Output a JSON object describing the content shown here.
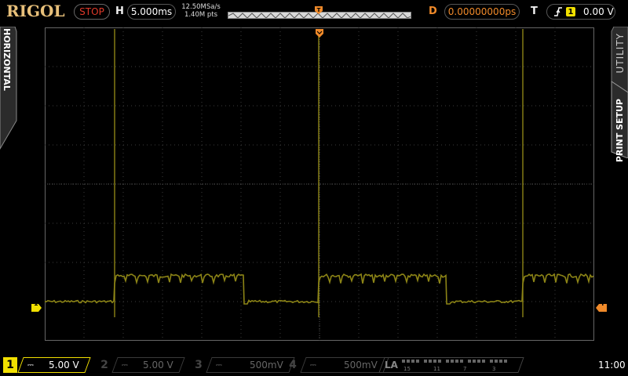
{
  "brand": "RIGOL",
  "run_state": "STOP",
  "horizontal": {
    "label": "H",
    "timebase": "5.000ms",
    "sample_rate": "12.50MSa/s",
    "memory_depth": "1.40M pts"
  },
  "delay": {
    "label": "D",
    "value": "0.00000000ps"
  },
  "trigger": {
    "label": "T",
    "slope_icon": "rising-edge-icon",
    "source": "1",
    "level": "0.00 V"
  },
  "side_tabs": {
    "left": "HORIZONTAL",
    "right_top": "UTILITY",
    "right_bottom": "PRINT SETUP"
  },
  "markers": {
    "ch1_ground": "1",
    "trigger_level": "T"
  },
  "channels": [
    {
      "num": "1",
      "coupling": "⎓",
      "scale": "5.00 V",
      "active": true
    },
    {
      "num": "2",
      "coupling": "⎓",
      "scale": "5.00 V",
      "active": false
    },
    {
      "num": "3",
      "coupling": "⎓",
      "scale": "500mV",
      "active": false
    },
    {
      "num": "4",
      "coupling": "⎓",
      "scale": "500mV",
      "active": false
    }
  ],
  "logic_analyzer": {
    "label": "LA",
    "groups": [
      "15",
      "11",
      "7",
      "3"
    ]
  },
  "clock": "11:00",
  "colors": {
    "ch1": "#f2e000",
    "trace": "#8c8416",
    "accent": "#f08a2a",
    "stop": "#e03a2a",
    "grid": "#3c3c3c"
  }
}
